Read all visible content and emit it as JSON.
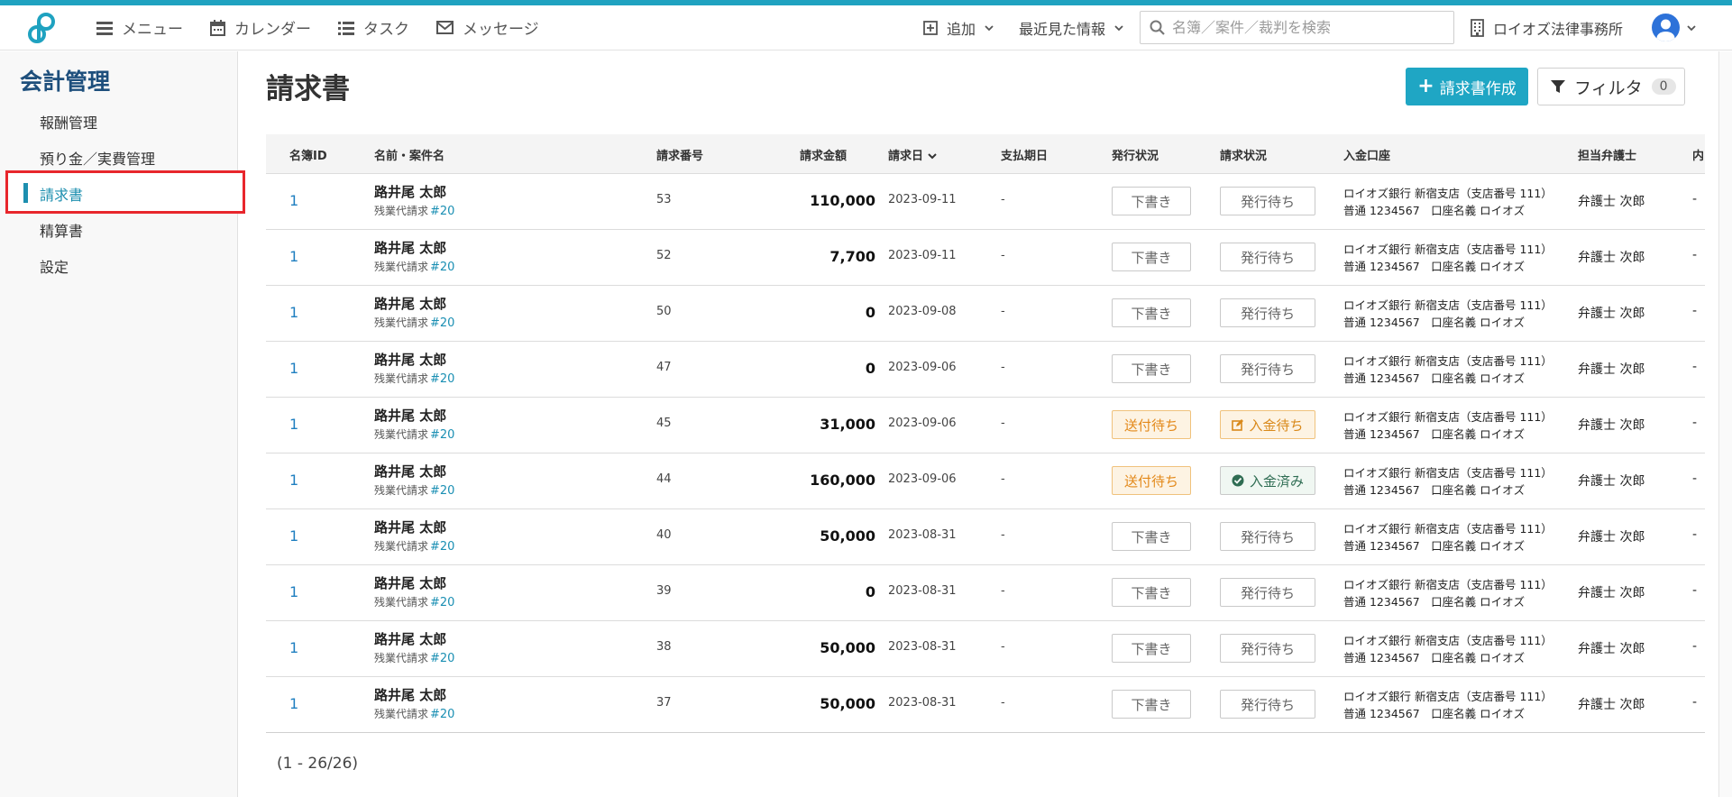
{
  "header": {
    "nav": [
      {
        "label": "メニュー",
        "icon": "menu-icon"
      },
      {
        "label": "カレンダー",
        "icon": "calendar-icon"
      },
      {
        "label": "タスク",
        "icon": "task-list-icon"
      },
      {
        "label": "メッセージ",
        "icon": "envelope-icon"
      }
    ],
    "add_label": "追加",
    "recent_label": "最近見た情報",
    "search_placeholder": "名簿／案件／裁判を検索",
    "firm_name": "ロイオズ法律事務所"
  },
  "sidebar": {
    "title": "会計管理",
    "items": [
      {
        "label": "報酬管理"
      },
      {
        "label": "預り金／実費管理"
      },
      {
        "label": "請求書"
      },
      {
        "label": "精算書"
      },
      {
        "label": "設定"
      }
    ],
    "active_index": 2
  },
  "main": {
    "title": "請求書",
    "create_button": "請求書作成",
    "filter_button": "フィルタ",
    "filter_count": "0"
  },
  "table": {
    "headers": {
      "id": "名簿ID",
      "name": "名前・案件名",
      "number": "請求番号",
      "amount": "請求金額",
      "date": "請求日",
      "due": "支払期日",
      "issue_status": "発行状況",
      "bill_status": "請求状況",
      "account": "入金口座",
      "lawyer": "担当弁護士",
      "extra": "内"
    },
    "rows": [
      {
        "id": "1",
        "name": "路井尾 太郎",
        "matter": "残業代請求",
        "matter_no": "#20",
        "number": "53",
        "amount": "110,000",
        "date": "2023-09-11",
        "due": "-",
        "issue": "下書き",
        "bill": "発行待ち",
        "bank1": "ロイオズ銀行 新宿支店（支店番号 111）",
        "bank2": "普通 1234567　口座名義 ロイオズ",
        "lawyer": "弁護士 次郎",
        "extra": "-"
      },
      {
        "id": "1",
        "name": "路井尾 太郎",
        "matter": "残業代請求",
        "matter_no": "#20",
        "number": "52",
        "amount": "7,700",
        "date": "2023-09-11",
        "due": "-",
        "issue": "下書き",
        "bill": "発行待ち",
        "bank1": "ロイオズ銀行 新宿支店（支店番号 111）",
        "bank2": "普通 1234567　口座名義 ロイオズ",
        "lawyer": "弁護士 次郎",
        "extra": "-"
      },
      {
        "id": "1",
        "name": "路井尾 太郎",
        "matter": "残業代請求",
        "matter_no": "#20",
        "number": "50",
        "amount": "0",
        "date": "2023-09-08",
        "due": "-",
        "issue": "下書き",
        "bill": "発行待ち",
        "bank1": "ロイオズ銀行 新宿支店（支店番号 111）",
        "bank2": "普通 1234567　口座名義 ロイオズ",
        "lawyer": "弁護士 次郎",
        "extra": "-"
      },
      {
        "id": "1",
        "name": "路井尾 太郎",
        "matter": "残業代請求",
        "matter_no": "#20",
        "number": "47",
        "amount": "0",
        "date": "2023-09-06",
        "due": "-",
        "issue": "下書き",
        "bill": "発行待ち",
        "bank1": "ロイオズ銀行 新宿支店（支店番号 111）",
        "bank2": "普通 1234567　口座名義 ロイオズ",
        "lawyer": "弁護士 次郎",
        "extra": "-"
      },
      {
        "id": "1",
        "name": "路井尾 太郎",
        "matter": "残業代請求",
        "matter_no": "#20",
        "number": "45",
        "amount": "31,000",
        "date": "2023-09-06",
        "due": "-",
        "issue": "送付待ち",
        "bill": "入金待ち",
        "bank1": "ロイオズ銀行 新宿支店（支店番号 111）",
        "bank2": "普通 1234567　口座名義 ロイオズ",
        "lawyer": "弁護士 次郎",
        "extra": "-"
      },
      {
        "id": "1",
        "name": "路井尾 太郎",
        "matter": "残業代請求",
        "matter_no": "#20",
        "number": "44",
        "amount": "160,000",
        "date": "2023-09-06",
        "due": "-",
        "issue": "送付待ち",
        "bill": "入金済み",
        "bank1": "ロイオズ銀行 新宿支店（支店番号 111）",
        "bank2": "普通 1234567　口座名義 ロイオズ",
        "lawyer": "弁護士 次郎",
        "extra": "-"
      },
      {
        "id": "1",
        "name": "路井尾 太郎",
        "matter": "残業代請求",
        "matter_no": "#20",
        "number": "40",
        "amount": "50,000",
        "date": "2023-08-31",
        "due": "-",
        "issue": "下書き",
        "bill": "発行待ち",
        "bank1": "ロイオズ銀行 新宿支店（支店番号 111）",
        "bank2": "普通 1234567　口座名義 ロイオズ",
        "lawyer": "弁護士 次郎",
        "extra": "-"
      },
      {
        "id": "1",
        "name": "路井尾 太郎",
        "matter": "残業代請求",
        "matter_no": "#20",
        "number": "39",
        "amount": "0",
        "date": "2023-08-31",
        "due": "-",
        "issue": "下書き",
        "bill": "発行待ち",
        "bank1": "ロイオズ銀行 新宿支店（支店番号 111）",
        "bank2": "普通 1234567　口座名義 ロイオズ",
        "lawyer": "弁護士 次郎",
        "extra": "-"
      },
      {
        "id": "1",
        "name": "路井尾 太郎",
        "matter": "残業代請求",
        "matter_no": "#20",
        "number": "38",
        "amount": "50,000",
        "date": "2023-08-31",
        "due": "-",
        "issue": "下書き",
        "bill": "発行待ち",
        "bank1": "ロイオズ銀行 新宿支店（支店番号 111）",
        "bank2": "普通 1234567　口座名義 ロイオズ",
        "lawyer": "弁護士 次郎",
        "extra": "-"
      },
      {
        "id": "1",
        "name": "路井尾 太郎",
        "matter": "残業代請求",
        "matter_no": "#20",
        "number": "37",
        "amount": "50,000",
        "date": "2023-08-31",
        "due": "-",
        "issue": "下書き",
        "bill": "発行待ち",
        "bank1": "ロイオズ銀行 新宿支店（支店番号 111）",
        "bank2": "普通 1234567　口座名義 ロイオズ",
        "lawyer": "弁護士 次郎",
        "extra": "-"
      }
    ]
  },
  "pagination": "(1 - 26/26)",
  "colors": {
    "accent": "#1fa6c4",
    "sidebar_title": "#1e4f7c",
    "highlight_box": "#e8262c",
    "orange_status": "#e3891a",
    "paid_status": "#2f6d53"
  }
}
